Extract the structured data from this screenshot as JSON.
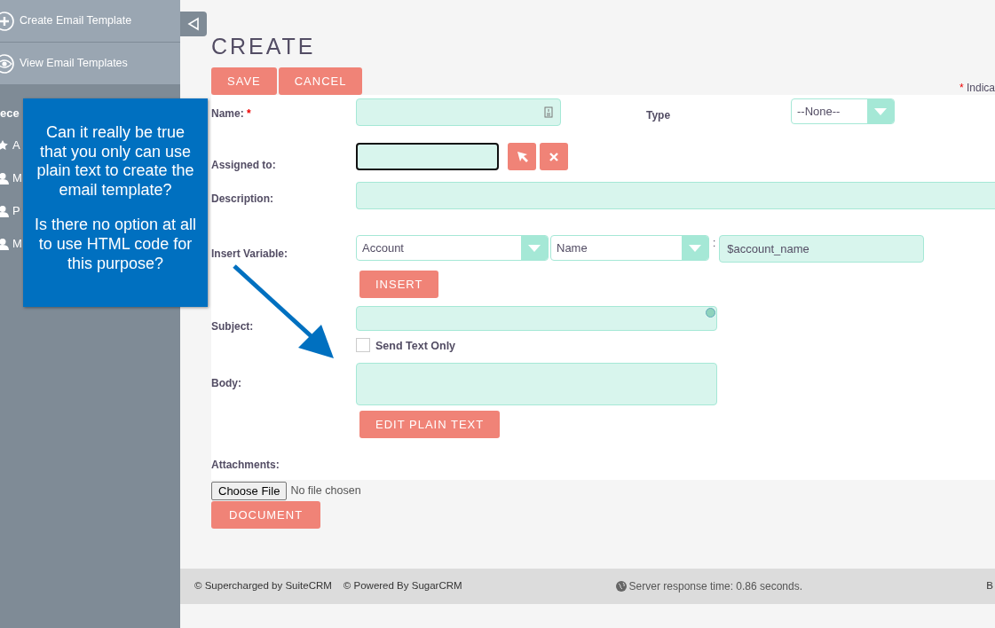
{
  "sidebar": {
    "actions": [
      {
        "label": "Create Email Template",
        "kind": "plus"
      },
      {
        "label": "View Email Templates",
        "kind": "eye"
      }
    ],
    "recent_heading": "ece",
    "recent_items": [
      {
        "label": "A",
        "kind": "star"
      },
      {
        "label": "M",
        "kind": "user"
      },
      {
        "label": "P",
        "kind": "user"
      },
      {
        "label": "M",
        "kind": "user"
      }
    ]
  },
  "page_title": "CREATE",
  "action_buttons": [
    "SAVE",
    "CANCEL"
  ],
  "required_note": {
    "mark": "*",
    "text": "Indica"
  },
  "form": {
    "name": {
      "label": "Name:",
      "required_mark": "*"
    },
    "type": {
      "label": "Type",
      "value": "--None--"
    },
    "assigned_to": {
      "label": "Assigned to:",
      "focused": true
    },
    "description": {
      "label": "Description:"
    },
    "insert_variable": {
      "label": "Insert Variable:",
      "module": "Account",
      "field": "Name",
      "separator": ":",
      "value": "$account_name",
      "button": "INSERT"
    },
    "subject": {
      "label": "Subject:"
    },
    "send_text_only": {
      "label": "Send Text Only",
      "checked": false
    },
    "body": {
      "label": "Body:",
      "button": "EDIT PLAIN TEXT"
    },
    "attachments": {
      "label": "Attachments:",
      "file_button": "Choose File",
      "file_status": "No file chosen",
      "document_button": "DOCUMENT"
    }
  },
  "footer": {
    "credits": [
      "© Supercharged by SuiteCRM",
      "© Powered By SugarCRM"
    ],
    "server_time": "Server response time: 0.86 seconds.",
    "right": "B"
  },
  "callout": [
    "Can it really be true that you only can use plain text to create the email template?",
    "Is there no option at all to use HTML code for this purpose?"
  ]
}
